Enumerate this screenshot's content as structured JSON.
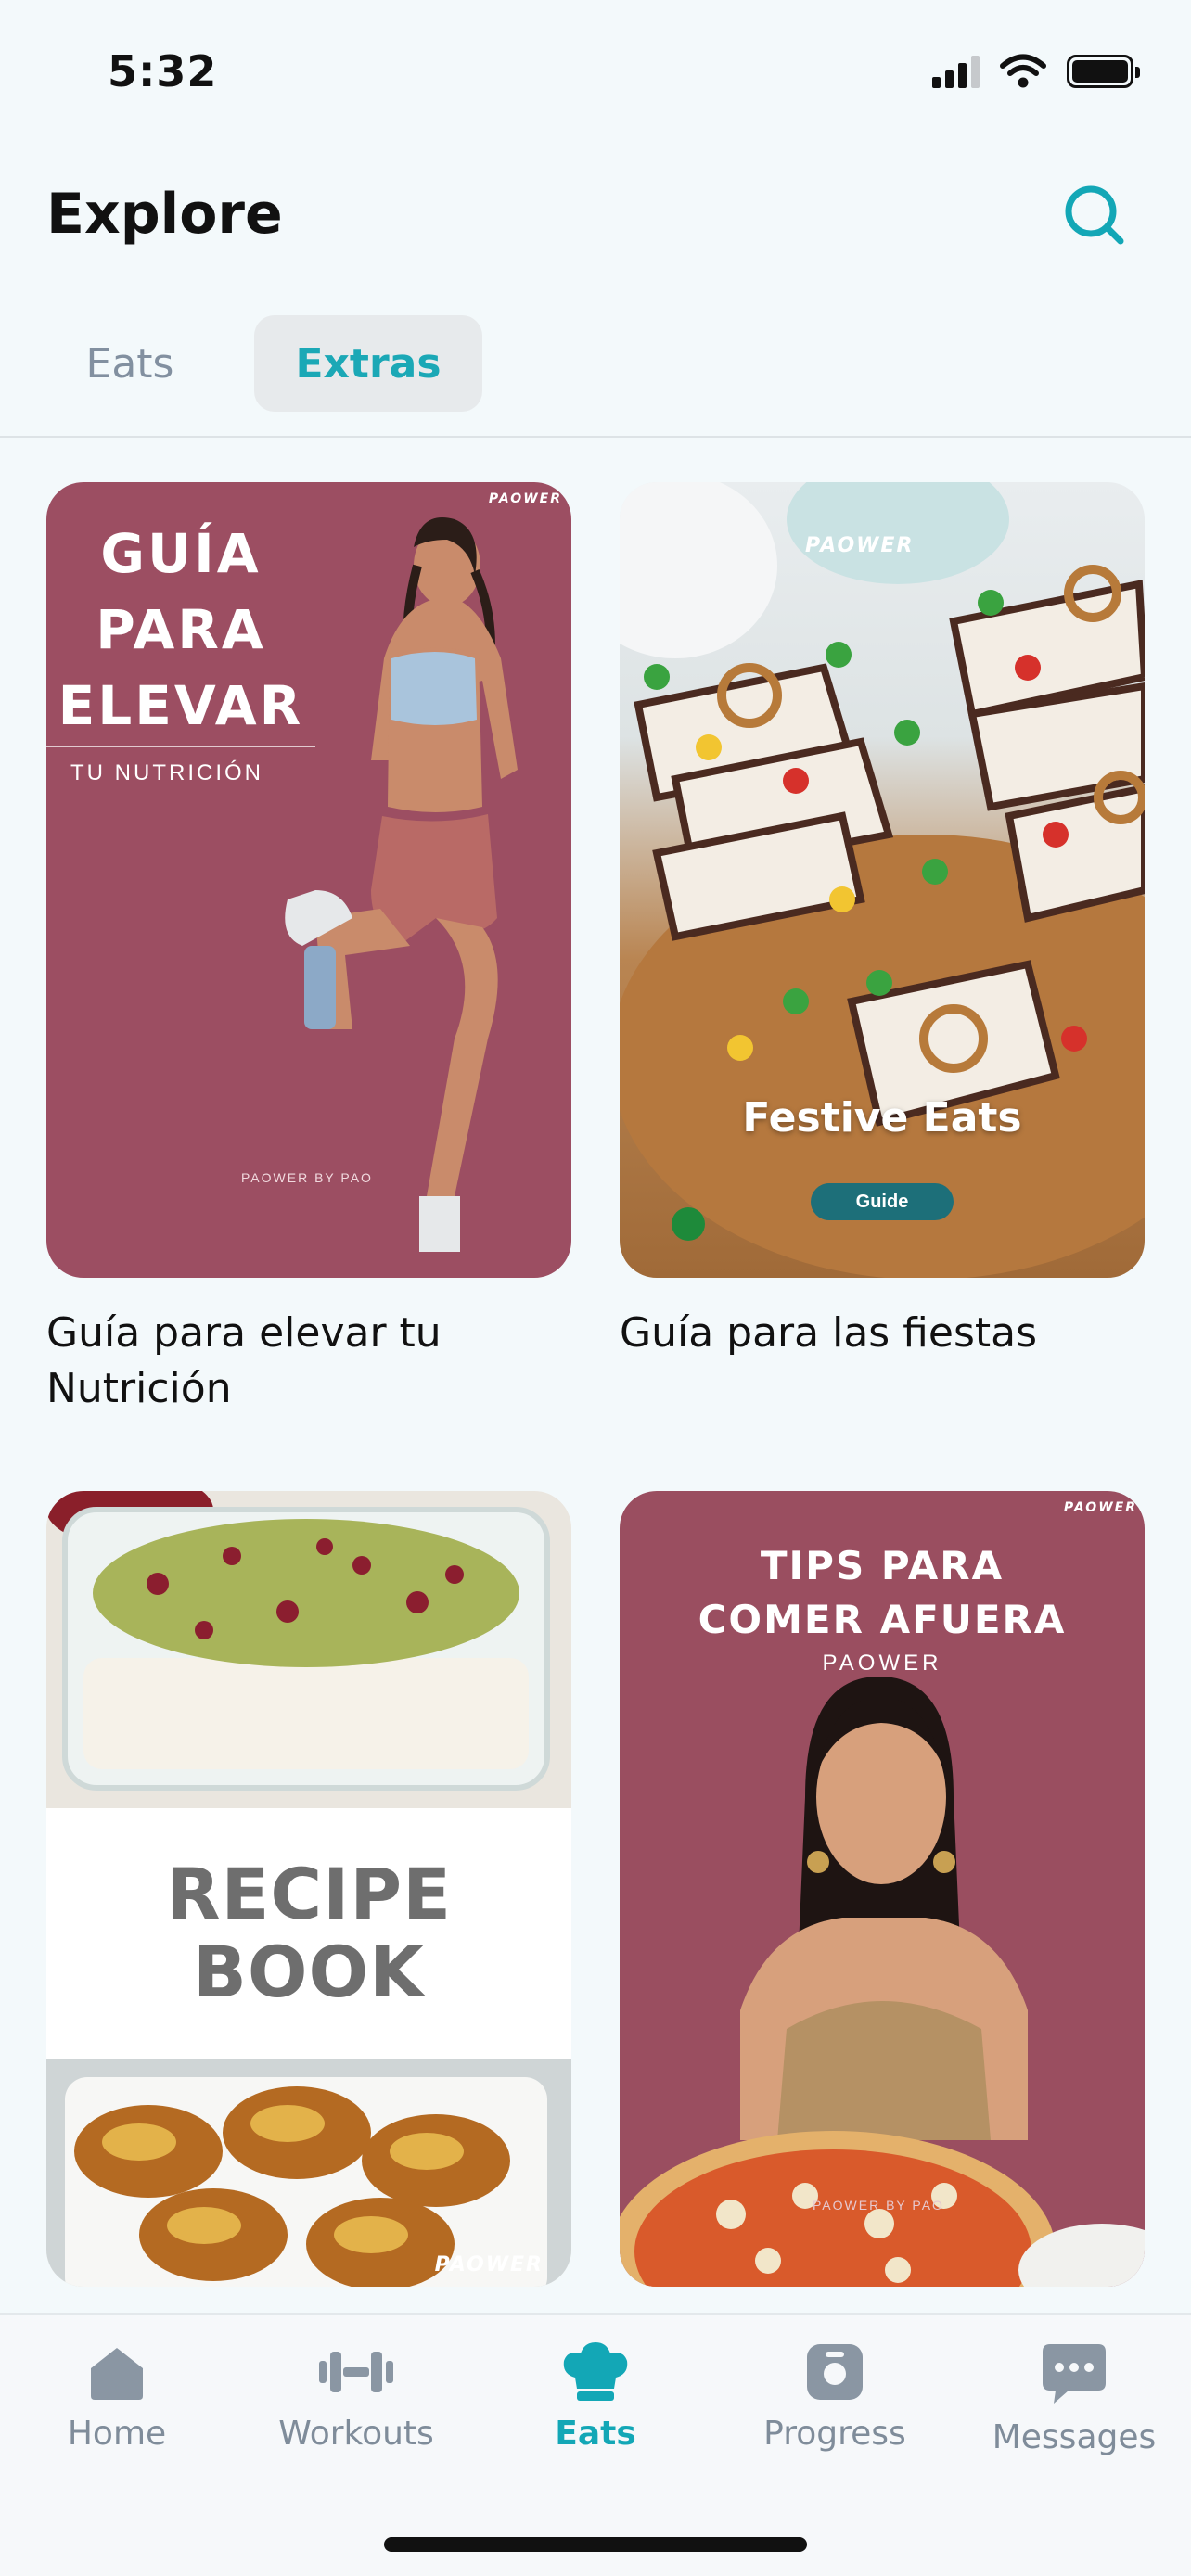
{
  "status_bar": {
    "time": "5:32"
  },
  "header": {
    "title": "Explore",
    "search_icon": "search-icon"
  },
  "tabs": [
    {
      "label": "Eats",
      "selected": false
    },
    {
      "label": "Extras",
      "selected": true
    }
  ],
  "colors": {
    "accent": "#13a7b6",
    "inactive": "#7f8c9a",
    "cover_maroon": "#9c4e62"
  },
  "cards": [
    {
      "label": "Guía para elevar tu Nutrición",
      "cover": {
        "brand": "PAOWER",
        "title_lines": [
          "GUÍA",
          "PARA",
          "ELEVAR"
        ],
        "subtitle": "TU NUTRICIÓN",
        "footer": "PAOWER BY PAO"
      }
    },
    {
      "label": "Guía para las fiestas",
      "cover": {
        "brand": "PAOWER",
        "title": "Festive Eats",
        "badge": "Guide"
      }
    },
    {
      "label": "",
      "cover": {
        "brand": "PAOWER",
        "title_lines": [
          "RECIPE",
          "BOOK"
        ]
      }
    },
    {
      "label": "",
      "cover": {
        "brand": "PAOWER",
        "title_lines": [
          "TIPS PARA",
          "COMER AFUERA"
        ],
        "subtitle": "PAOWER",
        "footer": "PAOWER BY PAO"
      }
    }
  ],
  "nav": [
    {
      "label": "Home",
      "icon": "home-icon",
      "active": false
    },
    {
      "label": "Workouts",
      "icon": "dumbbell-icon",
      "active": false
    },
    {
      "label": "Eats",
      "icon": "chef-hat-icon",
      "active": true
    },
    {
      "label": "Progress",
      "icon": "scale-icon",
      "active": false
    },
    {
      "label": "Messages",
      "icon": "chat-bubble-icon",
      "active": false
    }
  ]
}
